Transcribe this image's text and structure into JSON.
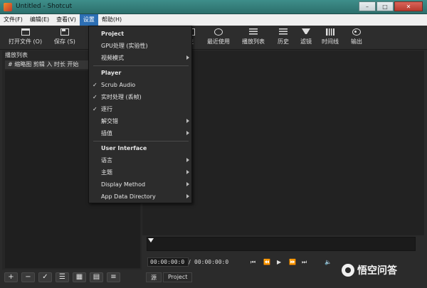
{
  "window": {
    "title": "Untitled - Shotcut",
    "controls": [
      "–",
      "□",
      "✕"
    ]
  },
  "menubar": {
    "items": [
      "文件(F)",
      "编辑(E)",
      "查看(V)",
      "设置",
      "帮助(H)"
    ]
  },
  "toolbar": {
    "open_label": "打开文件 (O)",
    "save_label": "保存 (S)",
    "props_label": "性",
    "recent_label": "最近使用",
    "playlist_label": "播放列表",
    "history_label": "历史",
    "filter_label": "滤镜",
    "timeline_label": "时间线",
    "export_label": "输出"
  },
  "playlist": {
    "title": "播放列表",
    "columns": "#  缩略图 剪辑 入 时长 开始"
  },
  "dropdown": {
    "project_header": "Project",
    "gpu": "GPU处理 (实验性)",
    "video_mode": "视频模式",
    "player_header": "Player",
    "scrub_audio": "Scrub Audio",
    "realtime": "实时处理 (丢帧)",
    "progressive": "逐行",
    "deinterlace": "解交错",
    "interpolation": "插值",
    "ui_header": "User Interface",
    "language": "语言",
    "theme": "主题",
    "display_method": "Display Method",
    "app_data": "App Data Directory",
    "check": "✓"
  },
  "player": {
    "timecode_current": "00:00:00:0",
    "separator": "/",
    "timecode_total": "00:00:00:0"
  },
  "tabs": {
    "source": "源",
    "project": "Project"
  },
  "bottom_buttons": [
    "+",
    "−",
    "✓",
    "☰",
    "▦",
    "▤",
    "≡"
  ],
  "watermark": {
    "text": "悟空问答"
  }
}
